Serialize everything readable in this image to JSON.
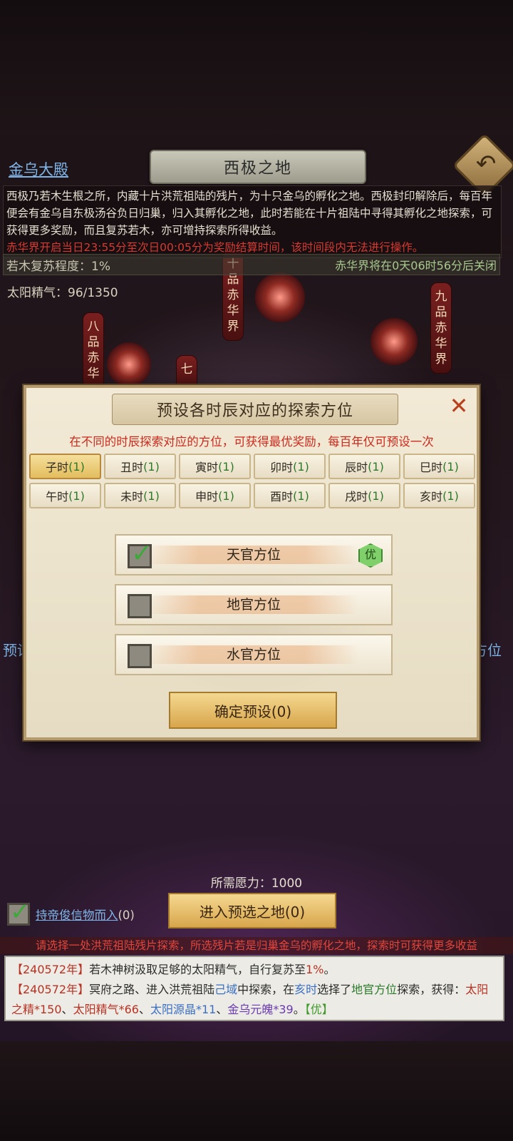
{
  "header": {
    "title": "西极之地",
    "palace_link": "金乌大殿"
  },
  "description": {
    "body": "西极乃若木生根之所，内藏十片洪荒祖陆的残片，为十只金乌的孵化之地。西极封印解除后，每百年便会有金乌自东极汤谷负日归巢，归入其孵化之地，此时若能在十片祖陆中寻得其孵化之地探索，可获得更多奖励，而且复苏若木，亦可增持探索所得收益。",
    "warning": "赤华界开启当日23:55分至次日00:05分为奖励结算时间，该时间段内无法进行操作。"
  },
  "status": {
    "revival": "若木复苏程度：1%",
    "closing": "赤华界将在0天06时56分后关闭",
    "sun_essence": "太阳精气：96/1350"
  },
  "lanterns": {
    "l10": "十品赤华界",
    "l9": "九品赤华界",
    "l8": "八品赤华",
    "l7": "七"
  },
  "side": {
    "left": "预设",
    "right": "方位"
  },
  "dialog": {
    "title": "预设各时辰对应的探索方位",
    "hint": "在不同的时辰探索对应的方位，可获得最优奖励，每百年仅可预设一次",
    "hours": [
      {
        "name": "子时",
        "count": "(1)",
        "selected": true
      },
      {
        "name": "丑时",
        "count": "(1)"
      },
      {
        "name": "寅时",
        "count": "(1)"
      },
      {
        "name": "卯时",
        "count": "(1)"
      },
      {
        "name": "辰时",
        "count": "(1)"
      },
      {
        "name": "巳时",
        "count": "(1)"
      },
      {
        "name": "午时",
        "count": "(1)"
      },
      {
        "name": "未时",
        "count": "(1)"
      },
      {
        "name": "申时",
        "count": "(1)"
      },
      {
        "name": "酉时",
        "count": "(1)"
      },
      {
        "name": "戌时",
        "count": "(1)"
      },
      {
        "name": "亥时",
        "count": "(1)"
      }
    ],
    "options": [
      {
        "label": "天官方位",
        "checked": true,
        "badge": "优"
      },
      {
        "label": "地官方位",
        "checked": false
      },
      {
        "label": "水官方位",
        "checked": false
      }
    ],
    "confirm": "确定预设(0)",
    "close_glyph": "✕"
  },
  "bottom": {
    "need": "所需愿力：1000",
    "enter": "进入预选之地(0)",
    "token_label": "持帝俊信物而入",
    "token_count": "(0)",
    "hint": "请选择一处洪荒祖陆残片探索，所选残片若是归巢金乌的孵化之地，探索时可获得更多收益"
  },
  "log": {
    "line1": {
      "year": "【240572年】",
      "text1": "若木神树汲取足够的太阳精气，自行复苏至",
      "pct": "1%",
      "text2": "。"
    },
    "line2": {
      "year": "【240572年】",
      "t1": "冥府之路、进入洪荒祖陆",
      "loc": "己域",
      "t2": "中探索，在",
      "time": "亥时",
      "t3": "选择了",
      "dir": "地官方位",
      "t4": "探索，获得：",
      "i1": "太阳之精*150",
      "sep1": "、",
      "i2": "太阳精气*66",
      "sep2": "、",
      "i3": "太阳源晶*11",
      "sep3": "、",
      "i4": "金乌元魄*39",
      "sep4": "。",
      "best": "【优】"
    }
  },
  "colors": {
    "accent_gold": "#d8a64c",
    "warning_red": "#cc2a1e",
    "link_blue": "#7fb5e8",
    "check_green": "#3fa83a"
  }
}
